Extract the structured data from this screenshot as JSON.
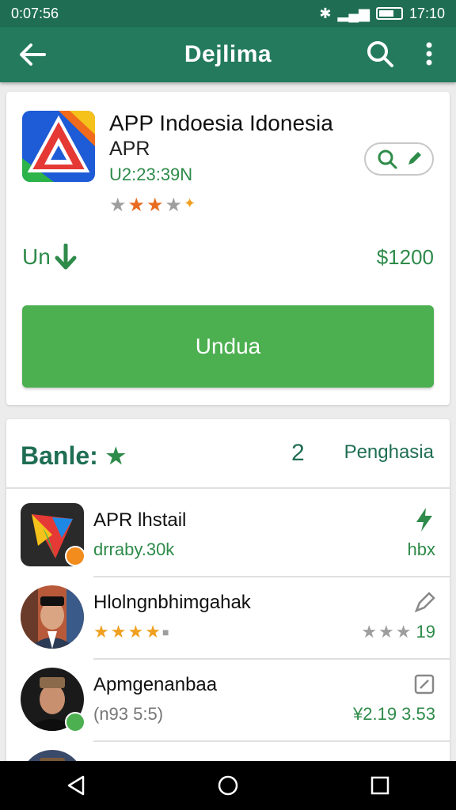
{
  "status": {
    "time_left": "0:07:56",
    "time_right": "17:10"
  },
  "appbar": {
    "title": "Dejlima"
  },
  "app": {
    "name": "APP Indoesia Idonesia",
    "subtitle": "APR",
    "code": "U2:23:39N",
    "rating_stars": 3,
    "download_label": "Un",
    "price": "$1200",
    "install_label": "Undua"
  },
  "section": {
    "title": "Banle:",
    "count": "2",
    "link": "Penghasia"
  },
  "rows": [
    {
      "name": "APR lhstail",
      "meta": "drraby.30k",
      "right_meta": "hbx",
      "right_icon": "flash-icon"
    },
    {
      "name": "Hlolngnbhimgahak",
      "meta": "",
      "right_meta": "19",
      "right_icon": "pen-icon",
      "rating": 4
    },
    {
      "name": "Apmgenanbaa",
      "meta": "(n93 5:5)",
      "right_meta": "¥2.19  3.53",
      "right_icon": "edit-icon"
    }
  ],
  "colors": {
    "primary": "#237a5c",
    "accent": "#4caf50",
    "text_green": "#2e8b4a"
  }
}
